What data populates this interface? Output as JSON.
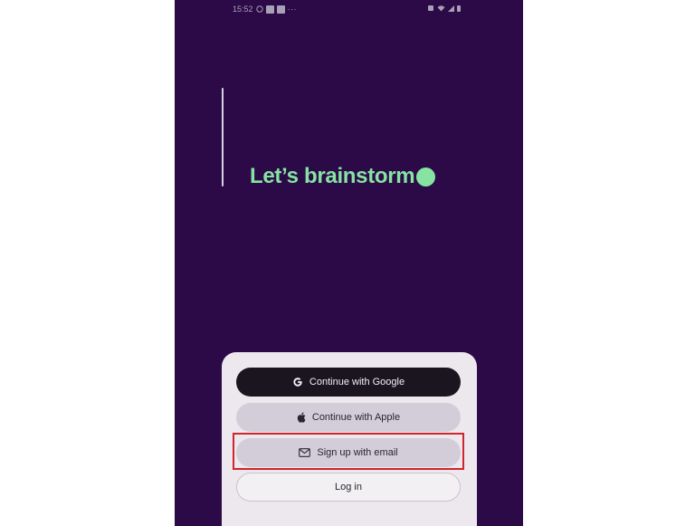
{
  "status_bar": {
    "time": "15:52",
    "more": "···"
  },
  "headline": {
    "text": "Let’s brainstorm"
  },
  "colors": {
    "background": "#2b0a47",
    "accent": "#86e3a2",
    "highlight": "#d0252a"
  },
  "auth": {
    "google_label": "Continue with Google",
    "apple_label": "Continue with Apple",
    "email_label": "Sign up with email",
    "login_label": "Log in"
  },
  "icons": {
    "google": "google-logo-icon",
    "apple": "apple-logo-icon",
    "email": "mail-envelope-icon"
  }
}
